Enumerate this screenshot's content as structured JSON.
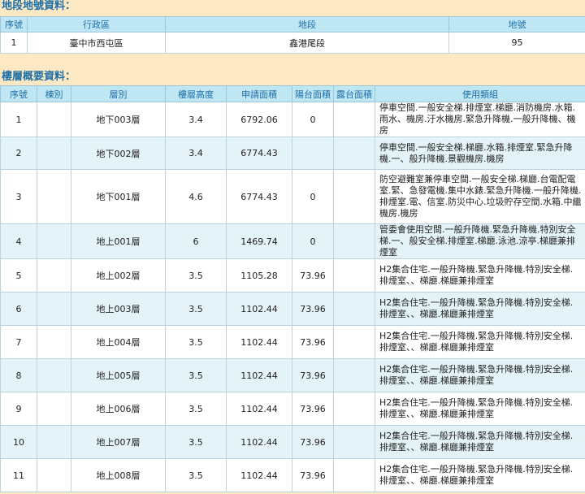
{
  "land": {
    "title": "地段地號資料：",
    "headers": [
      "序號",
      "行政區",
      "地段",
      "地號"
    ],
    "rows": [
      [
        "1",
        "臺中市西屯區",
        "鑫港尾段",
        "95"
      ]
    ]
  },
  "floors": {
    "title": "樓層概要資料：",
    "headers": [
      "序號",
      "棟別",
      "層別",
      "樓層高度",
      "申請面積",
      "陽台面積",
      "露台面積",
      "使用類組"
    ],
    "rows": [
      [
        "1",
        "",
        "地下003層",
        "3.4",
        "6792.06",
        "0",
        "",
        "停車空間.一般安全梯.排煙室.梯廳.消防機房.水箱.雨水、機房.汙水機房.緊急升降機.一般升降機、機房"
      ],
      [
        "2",
        "",
        "地下002層",
        "3.4",
        "6774.43",
        "",
        "",
        "停車空間.一般安全梯.梯廳.水箱.排煙室.緊急升降機.一、般升降機.景觀機房.機房"
      ],
      [
        "3",
        "",
        "地下001層",
        "4.6",
        "6774.43",
        "0",
        "",
        "防空避難室兼停車空間.一般安全梯.梯廳.台電配電室.緊、急發電機.集中水錶.緊急升降機.一般升降機.排煙室.電、信室.防災中心.垃圾貯存空間.水箱.中繼機房.機房"
      ],
      [
        "4",
        "",
        "地上001層",
        "6",
        "1469.74",
        "0",
        "",
        "管委會使用空間.一般升降機.緊急升降機.特別安全梯.一、般安全梯.排煙室.梯廳.泳池.涼亭.梯廳兼排煙室"
      ],
      [
        "5",
        "",
        "地上002層",
        "3.5",
        "1105.28",
        "73.96",
        "",
        "H2集合住宅.一般升降機.緊急升降機.特別安全梯.排煙室、、梯廳.梯廳兼排煙室"
      ],
      [
        "6",
        "",
        "地上003層",
        "3.5",
        "1102.44",
        "73.96",
        "",
        "H2集合住宅.一般升降機.緊急升降機.特別安全梯.排煙室、、梯廳.梯廳兼排煙室"
      ],
      [
        "7",
        "",
        "地上004層",
        "3.5",
        "1102.44",
        "73.96",
        "",
        "H2集合住宅.一般升降機.緊急升降機.特別安全梯.排煙室、、梯廳.梯廳兼排煙室"
      ],
      [
        "8",
        "",
        "地上005層",
        "3.5",
        "1102.44",
        "73.96",
        "",
        "H2集合住宅.一般升降機.緊急升降機.特別安全梯.排煙室、、梯廳.梯廳兼排煙室"
      ],
      [
        "9",
        "",
        "地上006層",
        "3.5",
        "1102.44",
        "73.96",
        "",
        "H2集合住宅.一般升降機.緊急升降機.特別安全梯.排煙室、、梯廳.梯廳兼排煙室"
      ],
      [
        "10",
        "",
        "地上007層",
        "3.5",
        "1102.44",
        "73.96",
        "",
        "H2集合住宅.一般升降機.緊急升降機.特別安全梯.排煙室、、梯廳.梯廳兼排煙室"
      ],
      [
        "11",
        "",
        "地上008層",
        "3.5",
        "1102.44",
        "73.96",
        "",
        "H2集合住宅.一般升降機.緊急升降機.特別安全梯.排煙室、、梯廳.梯廳兼排煙室"
      ]
    ]
  }
}
